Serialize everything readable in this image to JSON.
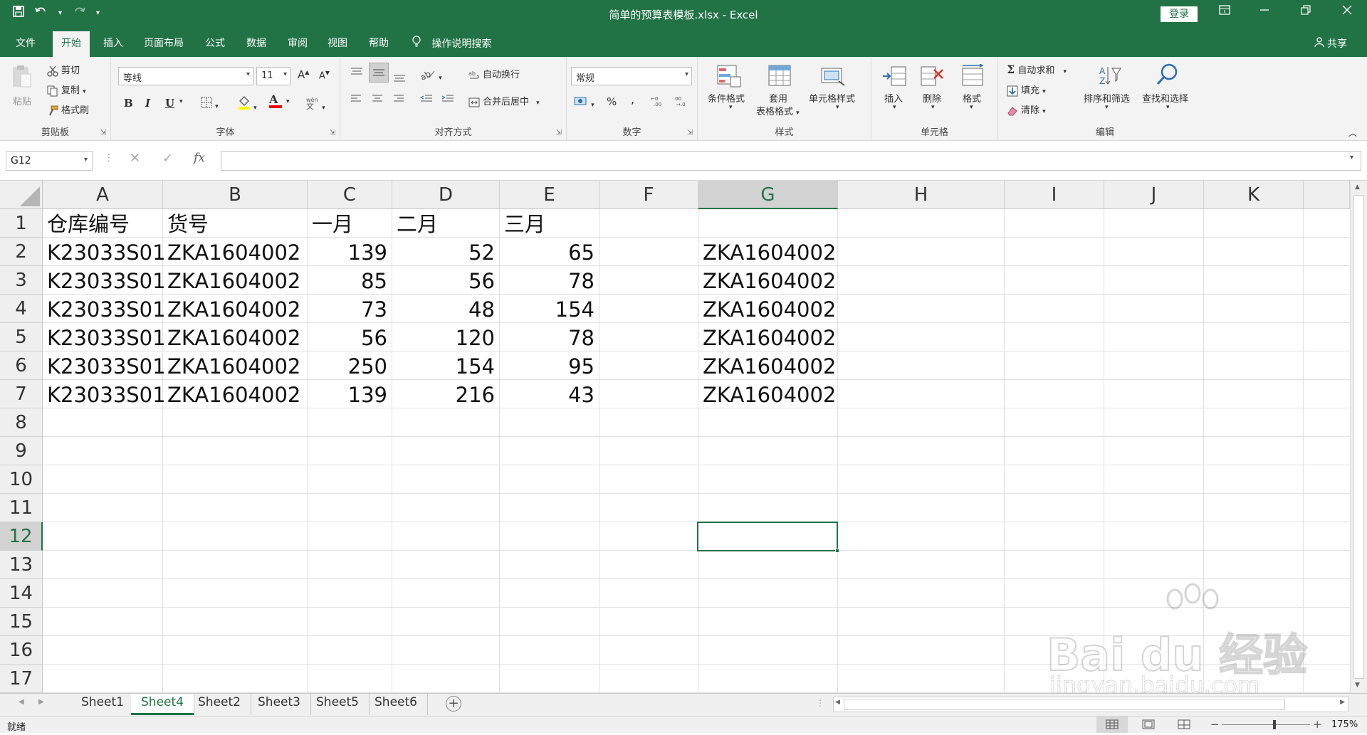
{
  "window": {
    "title": "简单的预算表模板.xlsx - Excel",
    "login_label": "登录",
    "share_label": "共享"
  },
  "tabs": [
    "文件",
    "开始",
    "插入",
    "页面布局",
    "公式",
    "数据",
    "审阅",
    "视图",
    "帮助"
  ],
  "active_tab": "开始",
  "tellme": "操作说明搜索",
  "ribbon": {
    "clipboard": {
      "paste": "粘贴",
      "cut": "剪切",
      "copy": "复制",
      "format_painter": "格式刷",
      "label": "剪贴板"
    },
    "font": {
      "name": "等线",
      "size": "11",
      "bold": "B",
      "italic": "I",
      "underline": "U",
      "grow": "A",
      "shrink": "A",
      "color_letter": "A",
      "label": "字体"
    },
    "alignment": {
      "wrap": "自动换行",
      "merge": "合并后居中",
      "label": "对齐方式"
    },
    "number": {
      "format": "常规",
      "percent": "%",
      "comma": ",",
      "label": "数字"
    },
    "styles": {
      "conditional": "条件格式",
      "table_1": "套用",
      "table_2": "表格格式",
      "cell_styles": "单元格样式",
      "label": "样式"
    },
    "cells": {
      "insert": "插入",
      "delete": "删除",
      "format": "格式",
      "label": "单元格"
    },
    "editing": {
      "autosum": "自动求和",
      "fill": "填充",
      "clear": "清除",
      "sort": "排序和筛选",
      "find": "查找和选择",
      "label": "编辑",
      "sigma": "Σ"
    }
  },
  "formula_bar": {
    "namebox": "G12",
    "formula": "",
    "fx": "fx"
  },
  "columns": [
    "A",
    "B",
    "C",
    "D",
    "E",
    "F",
    "G",
    "H",
    "I",
    "J",
    "K"
  ],
  "rows": [
    "1",
    "2",
    "3",
    "4",
    "5",
    "6",
    "7",
    "8",
    "9",
    "10",
    "11",
    "12",
    "13",
    "14",
    "15",
    "16",
    "17"
  ],
  "sheet": {
    "header": [
      "仓库编号",
      "货号",
      "一月",
      "二月",
      "三月"
    ],
    "data": [
      [
        "K23033S01",
        "ZKA1604002",
        "139",
        "52",
        "65",
        "ZKA1604002"
      ],
      [
        "K23033S01",
        "ZKA1604002",
        "85",
        "56",
        "78",
        "ZKA1604002"
      ],
      [
        "K23033S01",
        "ZKA1604002",
        "73",
        "48",
        "154",
        "ZKA1604002"
      ],
      [
        "K23033S01",
        "ZKA1604002",
        "56",
        "120",
        "78",
        "ZKA1604002"
      ],
      [
        "K23033S01",
        "ZKA1604002",
        "250",
        "154",
        "95",
        "ZKA1604002"
      ],
      [
        "K23033S01",
        "ZKA1604002",
        "139",
        "216",
        "43",
        "ZKA1604002"
      ]
    ]
  },
  "sheet_tabs": [
    "Sheet1",
    "Sheet4",
    "Sheet2",
    "Sheet3",
    "Sheet5",
    "Sheet6"
  ],
  "active_sheet": "Sheet4",
  "status": {
    "ready": "就绪",
    "zoom": "175%"
  },
  "watermark": {
    "logo": "Bai du 经验",
    "url": "jingyan.baidu.com"
  },
  "icons": {
    "save": "save-icon",
    "undo": "undo-icon",
    "redo": "redo-icon",
    "bulb": "lightbulb-icon",
    "share": "person-icon"
  },
  "colors": {
    "accent": "#217346"
  }
}
